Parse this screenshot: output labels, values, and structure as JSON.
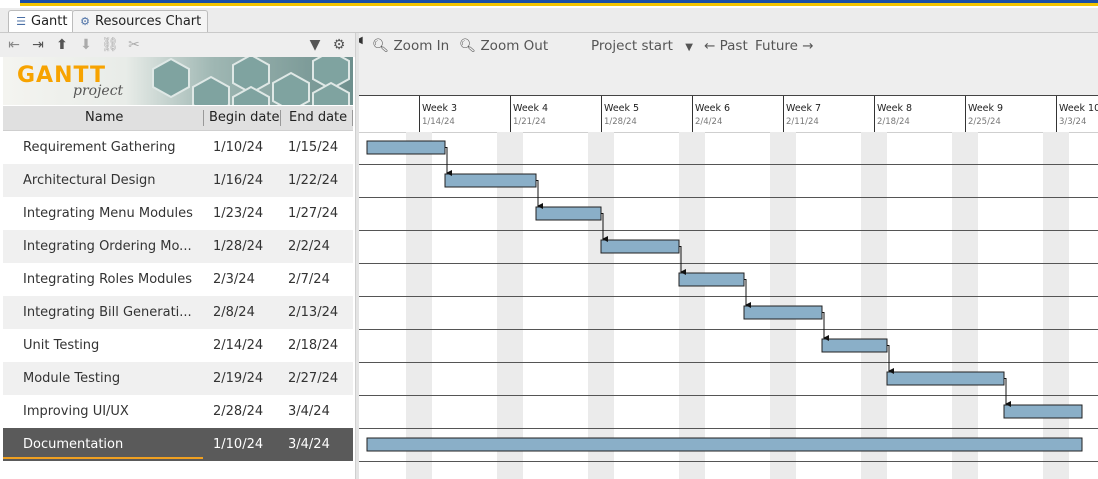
{
  "tabs": [
    {
      "label": "Gantt",
      "icon": "gantt-icon"
    },
    {
      "label": "Resources Chart",
      "icon": "resources-icon"
    }
  ],
  "toolbar": {
    "icons": [
      "outdent-icon",
      "indent-icon",
      "move-up-icon",
      "move-down-icon",
      "link-icon",
      "unlink-icon",
      "filter-icon",
      "settings-icon"
    ]
  },
  "logo": {
    "text_main": "GANTT",
    "text_sub": "project"
  },
  "table": {
    "columns": [
      "Name",
      "Begin date",
      "End date"
    ],
    "rows": [
      {
        "name": "Requirement Gathering",
        "begin": "1/10/24",
        "end": "1/15/24"
      },
      {
        "name": "Architectural Design",
        "begin": "1/16/24",
        "end": "1/22/24"
      },
      {
        "name": "Integrating Menu Modules",
        "begin": "1/23/24",
        "end": "1/27/24"
      },
      {
        "name": "Integrating Ordering Mo...",
        "begin": "1/28/24",
        "end": "2/2/24"
      },
      {
        "name": "Integrating Roles Modules",
        "begin": "2/3/24",
        "end": "2/7/24"
      },
      {
        "name": "Integrating Bill Generati...",
        "begin": "2/8/24",
        "end": "2/13/24"
      },
      {
        "name": "Unit Testing",
        "begin": "2/14/24",
        "end": "2/18/24"
      },
      {
        "name": "Module Testing",
        "begin": "2/19/24",
        "end": "2/27/24"
      },
      {
        "name": "Improving UI/UX",
        "begin": "2/28/24",
        "end": "3/4/24"
      },
      {
        "name": "Documentation",
        "begin": "1/10/24",
        "end": "3/4/24"
      }
    ],
    "selected_index": 9
  },
  "chart_toolbar": {
    "zoom_in": "Zoom In",
    "zoom_out": "Zoom Out",
    "project_start": "Project start",
    "past": "← Past",
    "future": "Future →"
  },
  "timeline": {
    "weeks": [
      {
        "label": "Week 3",
        "date": "1/14/24"
      },
      {
        "label": "Week 4",
        "date": "1/21/24"
      },
      {
        "label": "Week 5",
        "date": "1/28/24"
      },
      {
        "label": "Week 6",
        "date": "2/4/24"
      },
      {
        "label": "Week 7",
        "date": "2/11/24"
      },
      {
        "label": "Week 8",
        "date": "2/18/24"
      },
      {
        "label": "Week 9",
        "date": "2/25/24"
      },
      {
        "label": "Week 10",
        "date": "3/3/24"
      }
    ]
  },
  "colors": {
    "bar": "#8aafc8",
    "bar_border": "#222222",
    "selected_row": "#5a5a5a",
    "accent": "#f0a020"
  }
}
